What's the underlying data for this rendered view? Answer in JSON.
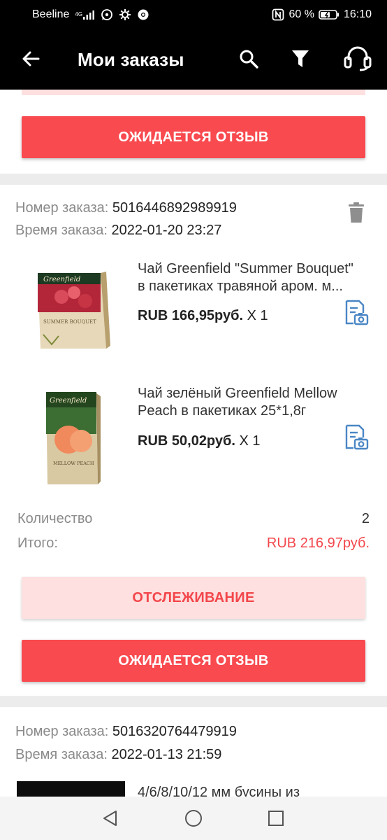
{
  "status_bar": {
    "carrier": "Beeline",
    "network": "4G",
    "battery": "60 %",
    "time": "16:10"
  },
  "app_bar": {
    "title": "Мои заказы",
    "icons": [
      "back-arrow-icon",
      "search-icon",
      "filter-icon",
      "support-headset-icon"
    ]
  },
  "top_card": {
    "review_button": "ОЖИДАЕТСЯ ОТЗЫВ"
  },
  "order": {
    "number_label": "Номер заказа:",
    "number": "5016446892989919",
    "time_label": "Время заказа:",
    "time": "2022-01-20 23:27",
    "items": [
      {
        "name_line1": "Чай Greenfield \"Summer Bouquet\"",
        "name_line2": "в пакетиках травяной аром. м...",
        "price": "RUB 166,95руб.",
        "qty": "X 1",
        "pack_brand": "Greenfield",
        "pack_title": "SUMMER BOUQUET",
        "pack_color": "#8a1d2b"
      },
      {
        "name_line1": "Чай зелёный Greenfield Mellow",
        "name_line2": "Peach в пакетиках 25*1,8г",
        "price": "RUB 50,02руб.",
        "qty": "X 1",
        "pack_brand": "Greenfield",
        "pack_title": "MELLOW PEACH",
        "pack_color": "#2f5a2a"
      }
    ],
    "quantity_label": "Количество",
    "quantity": "2",
    "total_label": "Итого:",
    "total": "RUB 216,97руб.",
    "tracking_button": "ОТСЛЕЖИВАНИЕ",
    "review_button": "ОЖИДАЕТСЯ ОТЗЫВ"
  },
  "next_order": {
    "number_label": "Номер заказа:",
    "number": "5016320764479919",
    "time_label": "Время заказа:",
    "time": "2022-01-13 21:59",
    "item_name": "4/6/8/10/12 мм бусины из"
  },
  "colors": {
    "accent": "#f84a4f",
    "accent_soft": "#fde0df",
    "icon_blue": "#4a86c5"
  }
}
